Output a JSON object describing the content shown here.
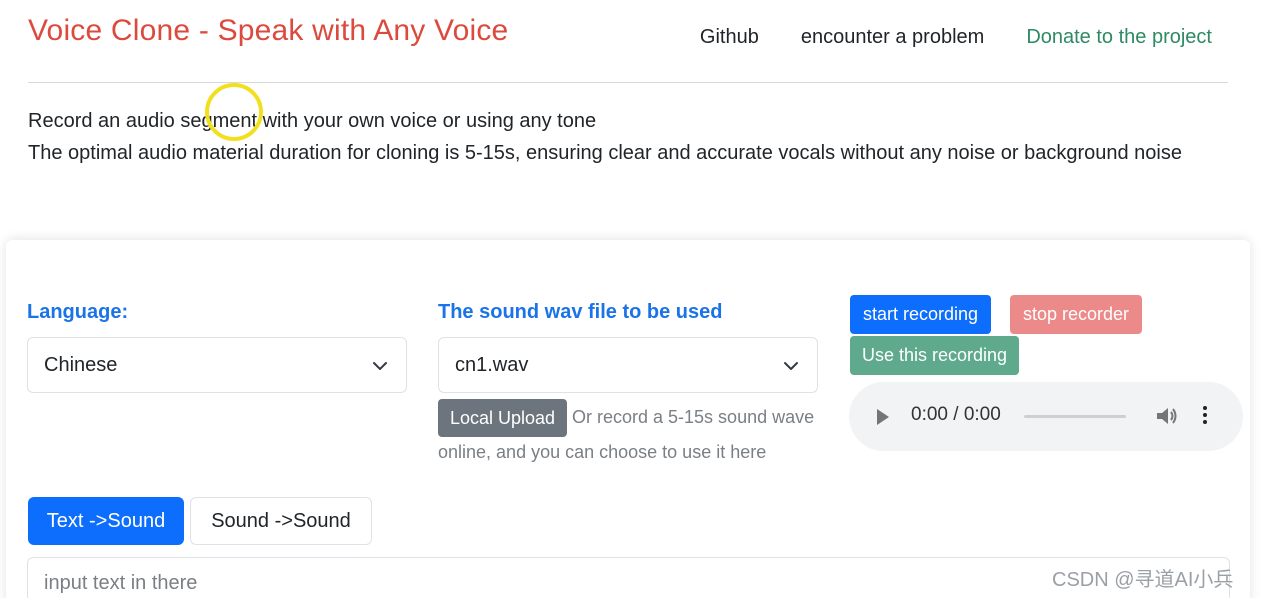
{
  "header": {
    "title": "Voice Clone - Speak with Any Voice",
    "nav": {
      "github": "Github",
      "problem": "encounter a problem",
      "donate": "Donate to the project"
    }
  },
  "intro": {
    "line1": "Record an audio segment with your own voice or using any tone",
    "line2": "The optimal audio material duration for cloning is 5-15s, ensuring clear and accurate vocals without any noise or background noise"
  },
  "form": {
    "language_label": "Language:",
    "language_value": "Chinese",
    "wav_label": "The sound wav file to be used",
    "wav_value": "cn1.wav",
    "upload_button": "Local Upload",
    "upload_hint": "Or record a 5-15s sound wave online, and you can choose to use it here",
    "start_recording": "start recording",
    "stop_recorder": "stop recorder",
    "use_recording": "Use this recording",
    "audio_time": "0:00 / 0:00"
  },
  "tabs": {
    "text_to_sound": "Text ->Sound",
    "sound_to_sound": "Sound ->Sound"
  },
  "input": {
    "placeholder": "input text in there"
  },
  "watermark": "CSDN @寻道AI小兵",
  "colors": {
    "title_red": "#dc4a3d",
    "donate_green": "#2d8a63",
    "label_blue": "#1a73e8",
    "primary_blue": "#0d6efd",
    "stop_red": "#ec8a8a",
    "use_green": "#5fa98c",
    "upload_gray": "#6c757d"
  },
  "icons": {
    "select_chevron": "chevron-down-icon",
    "play": "play-icon",
    "volume": "volume-icon",
    "more": "more-vertical-icon"
  }
}
